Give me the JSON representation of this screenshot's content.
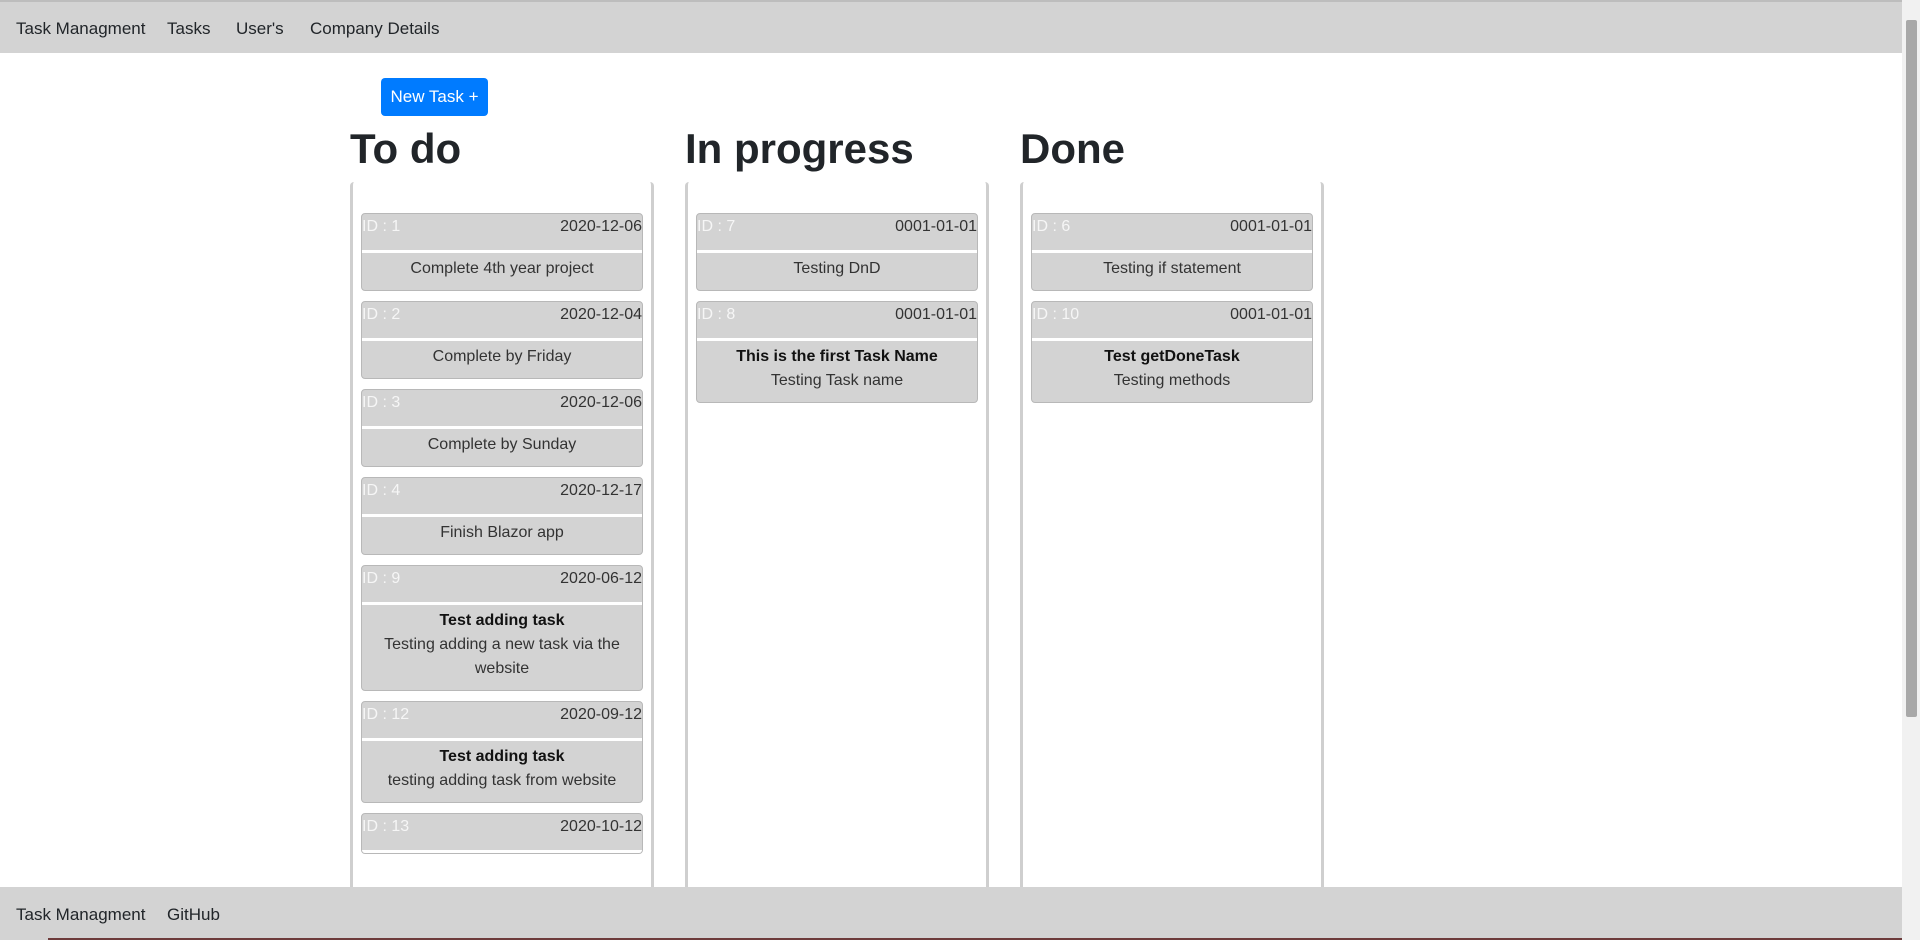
{
  "nav": {
    "brand": "Task Managment",
    "tasks": "Tasks",
    "users": "User's",
    "company": "Company Details"
  },
  "new_task_label": "New Task +",
  "columns": {
    "todo": {
      "title": "To do",
      "cards": [
        {
          "id": "ID : 1",
          "date": "2020-12-06",
          "desc": "Complete 4th year project"
        },
        {
          "id": "ID : 2",
          "date": "2020-12-04",
          "desc": "Complete by Friday"
        },
        {
          "id": "ID : 3",
          "date": "2020-12-06",
          "desc": "Complete by Sunday"
        },
        {
          "id": "ID : 4",
          "date": "2020-12-17",
          "desc": "Finish Blazor app"
        },
        {
          "id": "ID : 9",
          "date": "2020-06-12",
          "name": "Test adding task",
          "desc": "Testing adding a new task via the website"
        },
        {
          "id": "ID : 12",
          "date": "2020-09-12",
          "name": "Test adding task",
          "desc": "testing adding task from website"
        },
        {
          "id": "ID : 13",
          "date": "2020-10-12"
        }
      ]
    },
    "inprogress": {
      "title": "In progress",
      "cards": [
        {
          "id": "ID : 7",
          "date": "0001-01-01",
          "desc": "Testing DnD"
        },
        {
          "id": "ID : 8",
          "date": "0001-01-01",
          "name": "This is the first Task Name",
          "desc": "Testing Task name"
        }
      ]
    },
    "done": {
      "title": "Done",
      "cards": [
        {
          "id": "ID : 6",
          "date": "0001-01-01",
          "desc": "Testing if statement"
        },
        {
          "id": "ID : 10",
          "date": "0001-01-01",
          "name": "Test getDoneTask",
          "desc": "Testing methods"
        }
      ]
    }
  },
  "footer": {
    "brand": "Task Managment",
    "github": "GitHub"
  },
  "colors": {
    "bar": "#d3d3d3",
    "primary": "#007bff",
    "card": "#d3d3d3"
  }
}
